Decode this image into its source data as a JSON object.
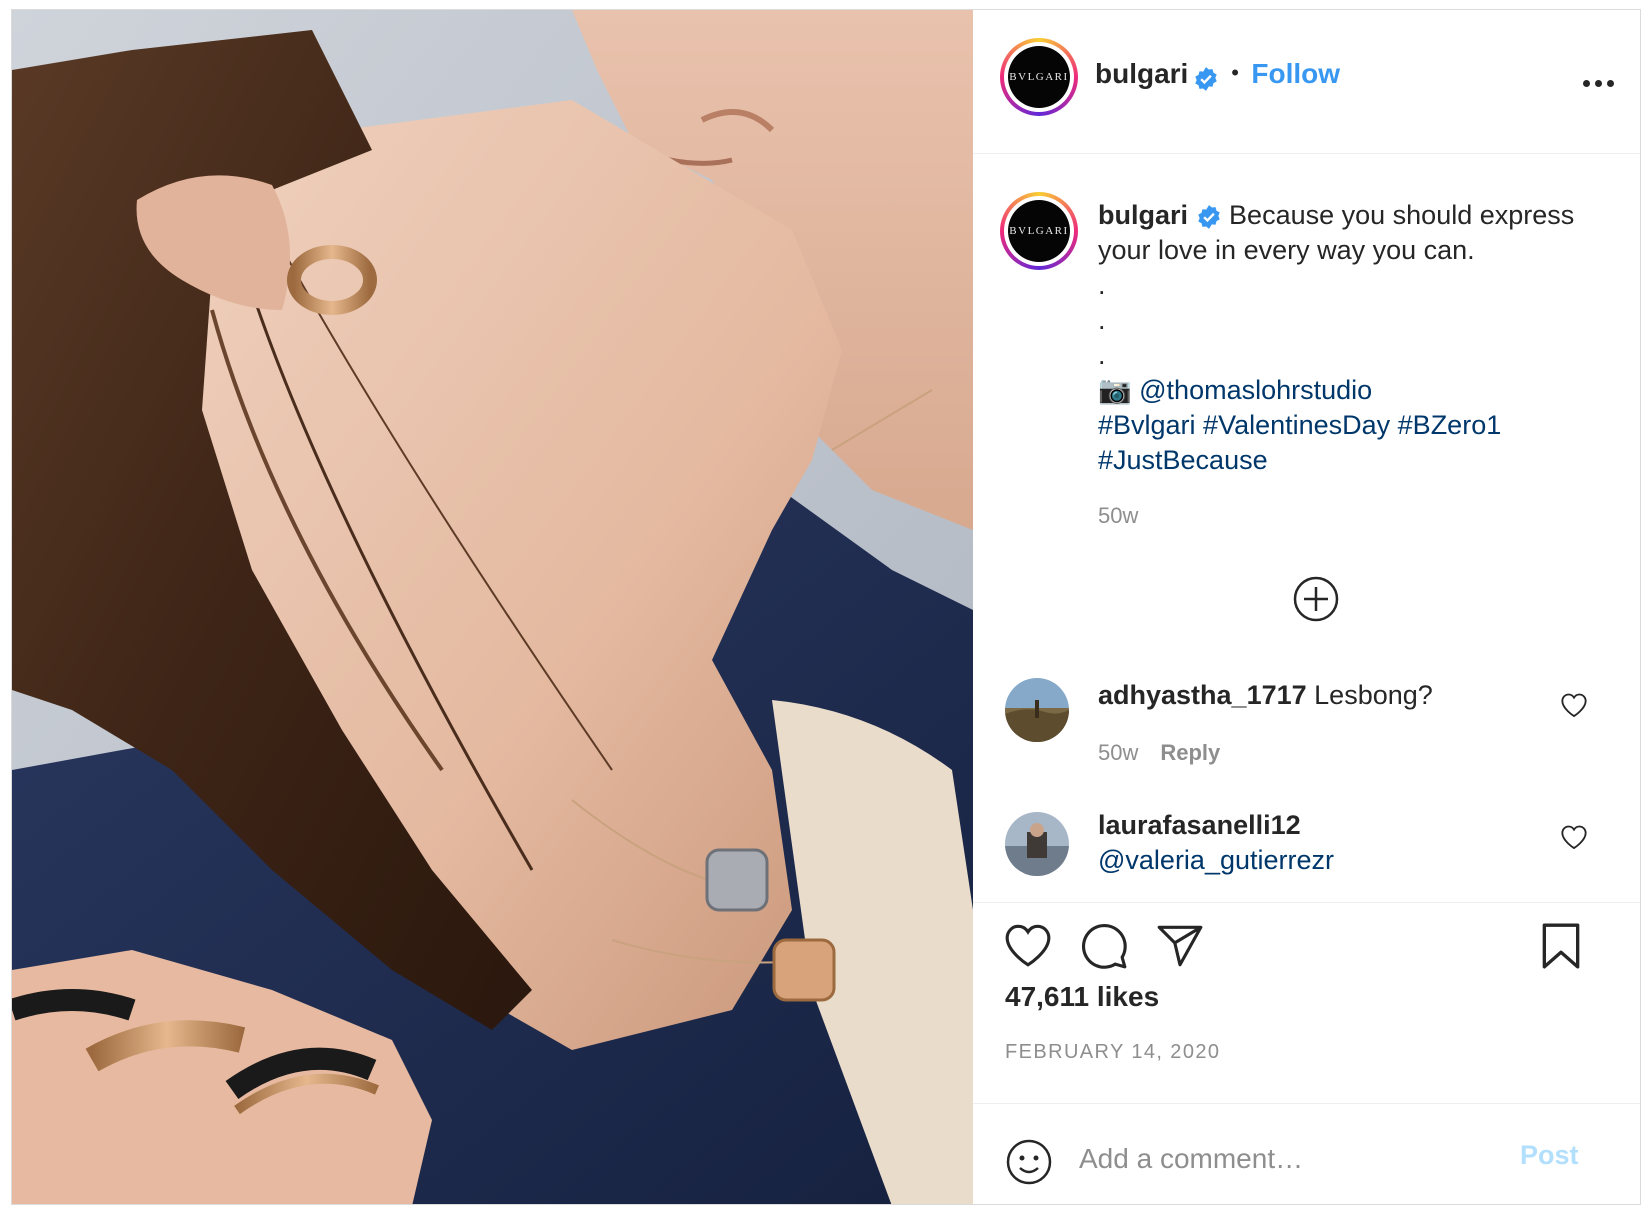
{
  "photo": {
    "description_icon": "image"
  },
  "header": {
    "username": "bulgari",
    "verified": true,
    "separator": "•",
    "follow_label": "Follow",
    "avatar_text": "BVLGARI",
    "more_icon": "more-horizontal-icon"
  },
  "caption": {
    "username": "bulgari",
    "text": "Because you should express your love in every way you can.",
    "dots": [
      ".",
      ".",
      "."
    ],
    "camera_emoji": "📷",
    "mention": "@thomaslohrstudio",
    "hashtags_line1": "#Bvlgari #ValentinesDay #BZero1",
    "hashtags_line2": "#JustBecause",
    "time": "50w"
  },
  "comments": [
    {
      "username": "adhyastha_1717",
      "text": "Lesbong?",
      "time": "50w",
      "reply_label": "Reply"
    },
    {
      "username": "laurafasanelli12",
      "text": "@valeria_gutierrezr"
    }
  ],
  "actions": {
    "likes": "47,611 likes",
    "date": "FEBRUARY 14, 2020"
  },
  "add_comment": {
    "placeholder": "Add a comment…",
    "post_label": "Post"
  },
  "colors": {
    "link_blue": "#3897f0",
    "hashtag": "#00376b",
    "muted": "#8e8e8e",
    "post_disabled": "#b2dffc"
  }
}
